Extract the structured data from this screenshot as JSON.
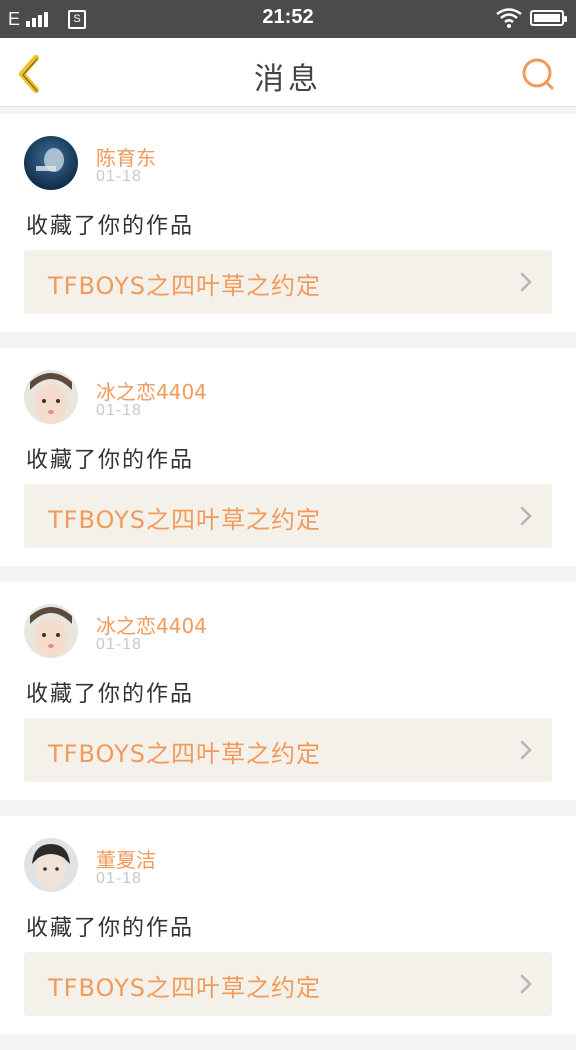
{
  "status_bar": {
    "network": "E",
    "sim_label": "S",
    "time": "21:52",
    "battery_level": 0.85
  },
  "header": {
    "title": "消息",
    "back_icon": "chevron-left-icon",
    "search_icon": "search-icon"
  },
  "colors": {
    "accent": "#f39a5b",
    "back_icon": "#f0c020"
  },
  "messages": [
    {
      "username": "陈育东",
      "date": "01-18",
      "action": "收藏了你的作品",
      "work_title": "TFBOYS之四叶草之约定"
    },
    {
      "username": "冰之恋4404",
      "date": "01-18",
      "action": "收藏了你的作品",
      "work_title": "TFBOYS之四叶草之约定"
    },
    {
      "username": "冰之恋4404",
      "date": "01-18",
      "action": "收藏了你的作品",
      "work_title": "TFBOYS之四叶草之约定"
    },
    {
      "username": "董夏洁",
      "date": "01-18",
      "action": "收藏了你的作品",
      "work_title": "TFBOYS之四叶草之约定"
    }
  ]
}
